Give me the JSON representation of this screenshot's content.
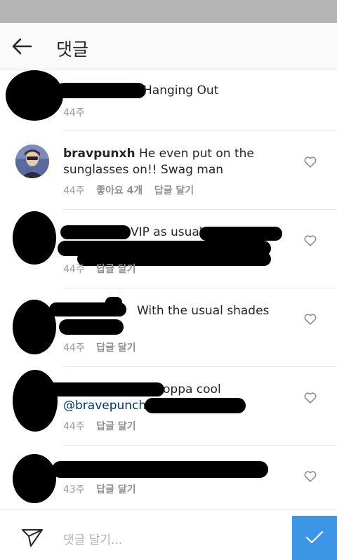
{
  "header": {
    "title": "댓글"
  },
  "comments": [
    {
      "text": "Hanging Out",
      "time": "44주"
    },
    {
      "username": "bravpunxh",
      "text_line1": "He even put on the",
      "text_line2": "sunglasses on!! Swag man",
      "time": "44주",
      "likes": "좋아요 4개",
      "reply": "답글 달기"
    },
    {
      "text": "VIP as usual",
      "time": "44주",
      "reply": "답글 달기"
    },
    {
      "text": "With the usual shades",
      "time": "44주",
      "reply": "답글 달기"
    },
    {
      "text_line1": "oppa cool",
      "mention": "@bravepunch",
      "time": "44주",
      "reply": "답글 달기"
    },
    {
      "time": "43주",
      "reply": "답글 달기"
    }
  ],
  "footer": {
    "placeholder": "댓글 달기..."
  },
  "colors": {
    "post_button": "#3d95e6",
    "status_bar": "#b4b4b4"
  },
  "icons": [
    "back-arrow-icon",
    "heart-icon",
    "send-icon",
    "check-icon"
  ]
}
